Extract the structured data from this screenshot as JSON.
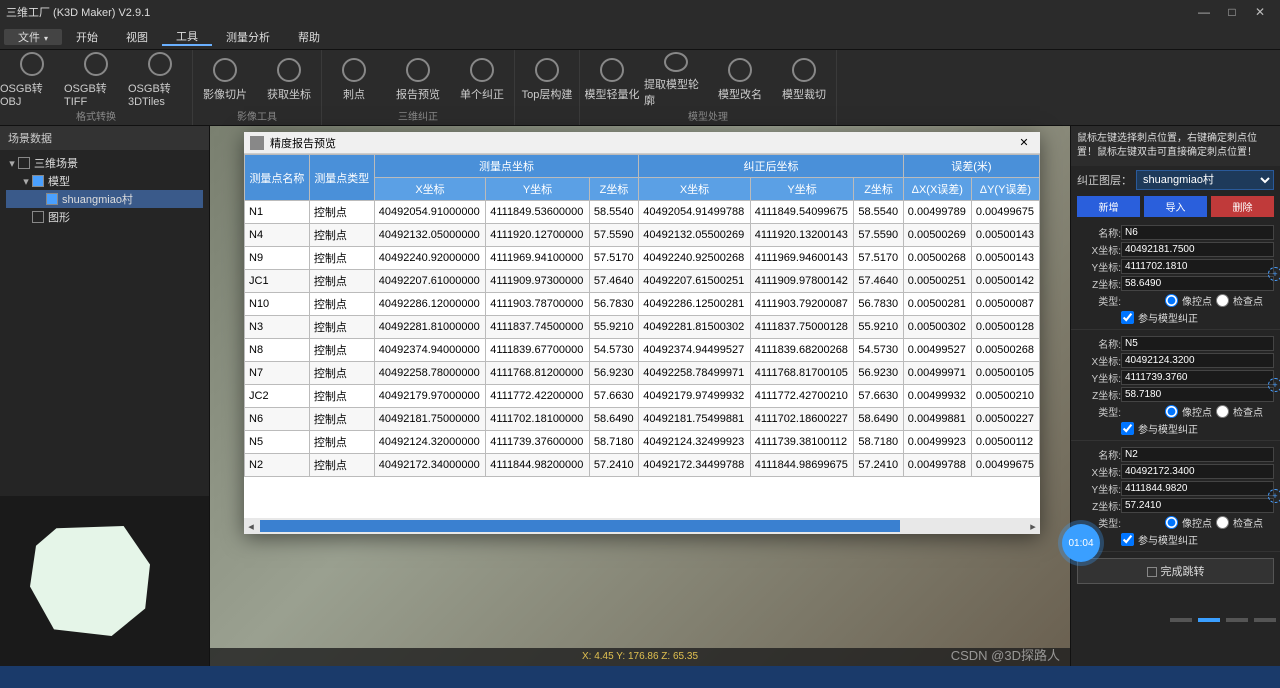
{
  "app": {
    "title": "三维工厂 (K3D Maker) V2.9.1"
  },
  "menus": {
    "file": "文件",
    "start": "开始",
    "view": "视图",
    "tools": "工具",
    "analysis": "测量分析",
    "help": "帮助"
  },
  "toolbar": {
    "groups": [
      {
        "label": "格式转换",
        "items": [
          {
            "id": "osgb-obj",
            "label": "OSGB转OBJ"
          },
          {
            "id": "osgb-tiff",
            "label": "OSGB转TIFF"
          },
          {
            "id": "osgb-3dtiles",
            "label": "OSGB转3DTiles"
          }
        ]
      },
      {
        "label": "影像工具",
        "items": [
          {
            "id": "img-slice",
            "label": "影像切片"
          },
          {
            "id": "get-coord",
            "label": "获取坐标"
          }
        ]
      },
      {
        "label": "三维纠正",
        "items": [
          {
            "id": "ci-point",
            "label": "刺点"
          },
          {
            "id": "report-preview",
            "label": "报告预览"
          },
          {
            "id": "single-correct",
            "label": "单个纠正"
          }
        ]
      },
      {
        "label": "",
        "items": [
          {
            "id": "top-layer",
            "label": "Top层构建"
          }
        ]
      },
      {
        "label": "模型处理",
        "items": [
          {
            "id": "model-light",
            "label": "模型轻量化"
          },
          {
            "id": "extract-outline",
            "label": "提取模型轮廓"
          },
          {
            "id": "model-rename",
            "label": "模型改名"
          },
          {
            "id": "model-clip",
            "label": "模型裁切"
          }
        ]
      }
    ]
  },
  "scene": {
    "header": "场景数据",
    "tree": [
      {
        "label": "三维场景",
        "level": 0,
        "expand": "▾",
        "checked": false
      },
      {
        "label": "模型",
        "level": 1,
        "expand": "▾",
        "checked": true
      },
      {
        "label": "shuangmiao村",
        "level": 2,
        "expand": "",
        "checked": true,
        "sel": true
      },
      {
        "label": "图形",
        "level": 1,
        "expand": "",
        "checked": false
      }
    ]
  },
  "dialog": {
    "title": "精度报告预览",
    "colgroups": [
      {
        "label": "测量点坐标",
        "span": 3
      },
      {
        "label": "纠正后坐标",
        "span": 3
      },
      {
        "label": "误差(米)",
        "span": 2
      }
    ],
    "cols": [
      "测量点名称",
      "测量点类型",
      "X坐标",
      "Y坐标",
      "Z坐标",
      "X坐标",
      "Y坐标",
      "Z坐标",
      "ΔX(X误差)",
      "ΔY(Y误差)"
    ],
    "rows": [
      [
        "N1",
        "控制点",
        "40492054.91000000",
        "4111849.53600000",
        "58.5540",
        "40492054.91499788",
        "4111849.54099675",
        "58.5540",
        "0.00499789",
        "0.00499675"
      ],
      [
        "N4",
        "控制点",
        "40492132.05000000",
        "4111920.12700000",
        "57.5590",
        "40492132.05500269",
        "4111920.13200143",
        "57.5590",
        "0.00500269",
        "0.00500143"
      ],
      [
        "N9",
        "控制点",
        "40492240.92000000",
        "4111969.94100000",
        "57.5170",
        "40492240.92500268",
        "4111969.94600143",
        "57.5170",
        "0.00500268",
        "0.00500143"
      ],
      [
        "JC1",
        "控制点",
        "40492207.61000000",
        "4111909.97300000",
        "57.4640",
        "40492207.61500251",
        "4111909.97800142",
        "57.4640",
        "0.00500251",
        "0.00500142"
      ],
      [
        "N10",
        "控制点",
        "40492286.12000000",
        "4111903.78700000",
        "56.7830",
        "40492286.12500281",
        "4111903.79200087",
        "56.7830",
        "0.00500281",
        "0.00500087"
      ],
      [
        "N3",
        "控制点",
        "40492281.81000000",
        "4111837.74500000",
        "55.9210",
        "40492281.81500302",
        "4111837.75000128",
        "55.9210",
        "0.00500302",
        "0.00500128"
      ],
      [
        "N8",
        "控制点",
        "40492374.94000000",
        "4111839.67700000",
        "54.5730",
        "40492374.94499527",
        "4111839.68200268",
        "54.5730",
        "0.00499527",
        "0.00500268"
      ],
      [
        "N7",
        "控制点",
        "40492258.78000000",
        "4111768.81200000",
        "56.9230",
        "40492258.78499971",
        "4111768.81700105",
        "56.9230",
        "0.00499971",
        "0.00500105"
      ],
      [
        "JC2",
        "控制点",
        "40492179.97000000",
        "4111772.42200000",
        "57.6630",
        "40492179.97499932",
        "4111772.42700210",
        "57.6630",
        "0.00499932",
        "0.00500210"
      ],
      [
        "N6",
        "控制点",
        "40492181.75000000",
        "4111702.18100000",
        "58.6490",
        "40492181.75499881",
        "4111702.18600227",
        "58.6490",
        "0.00499881",
        "0.00500227"
      ],
      [
        "N5",
        "控制点",
        "40492124.32000000",
        "4111739.37600000",
        "58.7180",
        "40492124.32499923",
        "4111739.38100112",
        "58.7180",
        "0.00499923",
        "0.00500112"
      ],
      [
        "N2",
        "控制点",
        "40492172.34000000",
        "4111844.98200000",
        "57.2410",
        "40492172.34499788",
        "4111844.98699675",
        "57.2410",
        "0.00499788",
        "0.00499675"
      ]
    ]
  },
  "right": {
    "hint": "鼠标左键选择刺点位置，右键确定刺点位置！鼠标左键双击可直接确定刺点位置！",
    "layer_label": "纠正图层：",
    "layer_value": "shuangmiao村",
    "btn_new": "新增",
    "btn_import": "导入",
    "btn_delete": "删除",
    "labels": {
      "name": "名称:",
      "x": "X坐标:",
      "y": "Y坐标:",
      "z": "Z坐标:",
      "type": "类型:",
      "r1": "像控点",
      "r2": "检查点",
      "chk": "参与模型纠正"
    },
    "points": [
      {
        "name": "N6",
        "x": "40492181.7500",
        "y": "4111702.1810",
        "z": "58.6490",
        "radio": 0,
        "chk": true
      },
      {
        "name": "N5",
        "x": "40492124.3200",
        "y": "4111739.3760",
        "z": "58.7180",
        "radio": 0,
        "chk": true
      },
      {
        "name": "N2",
        "x": "40492172.3400",
        "y": "4111844.9820",
        "z": "57.2410",
        "radio": 0,
        "chk": true
      }
    ],
    "done": "完成跳转"
  },
  "status": "X: 4.45 Y: 176.86  Z: 65.35",
  "watermark": "CSDN @3D探路人",
  "badge": "01:04"
}
